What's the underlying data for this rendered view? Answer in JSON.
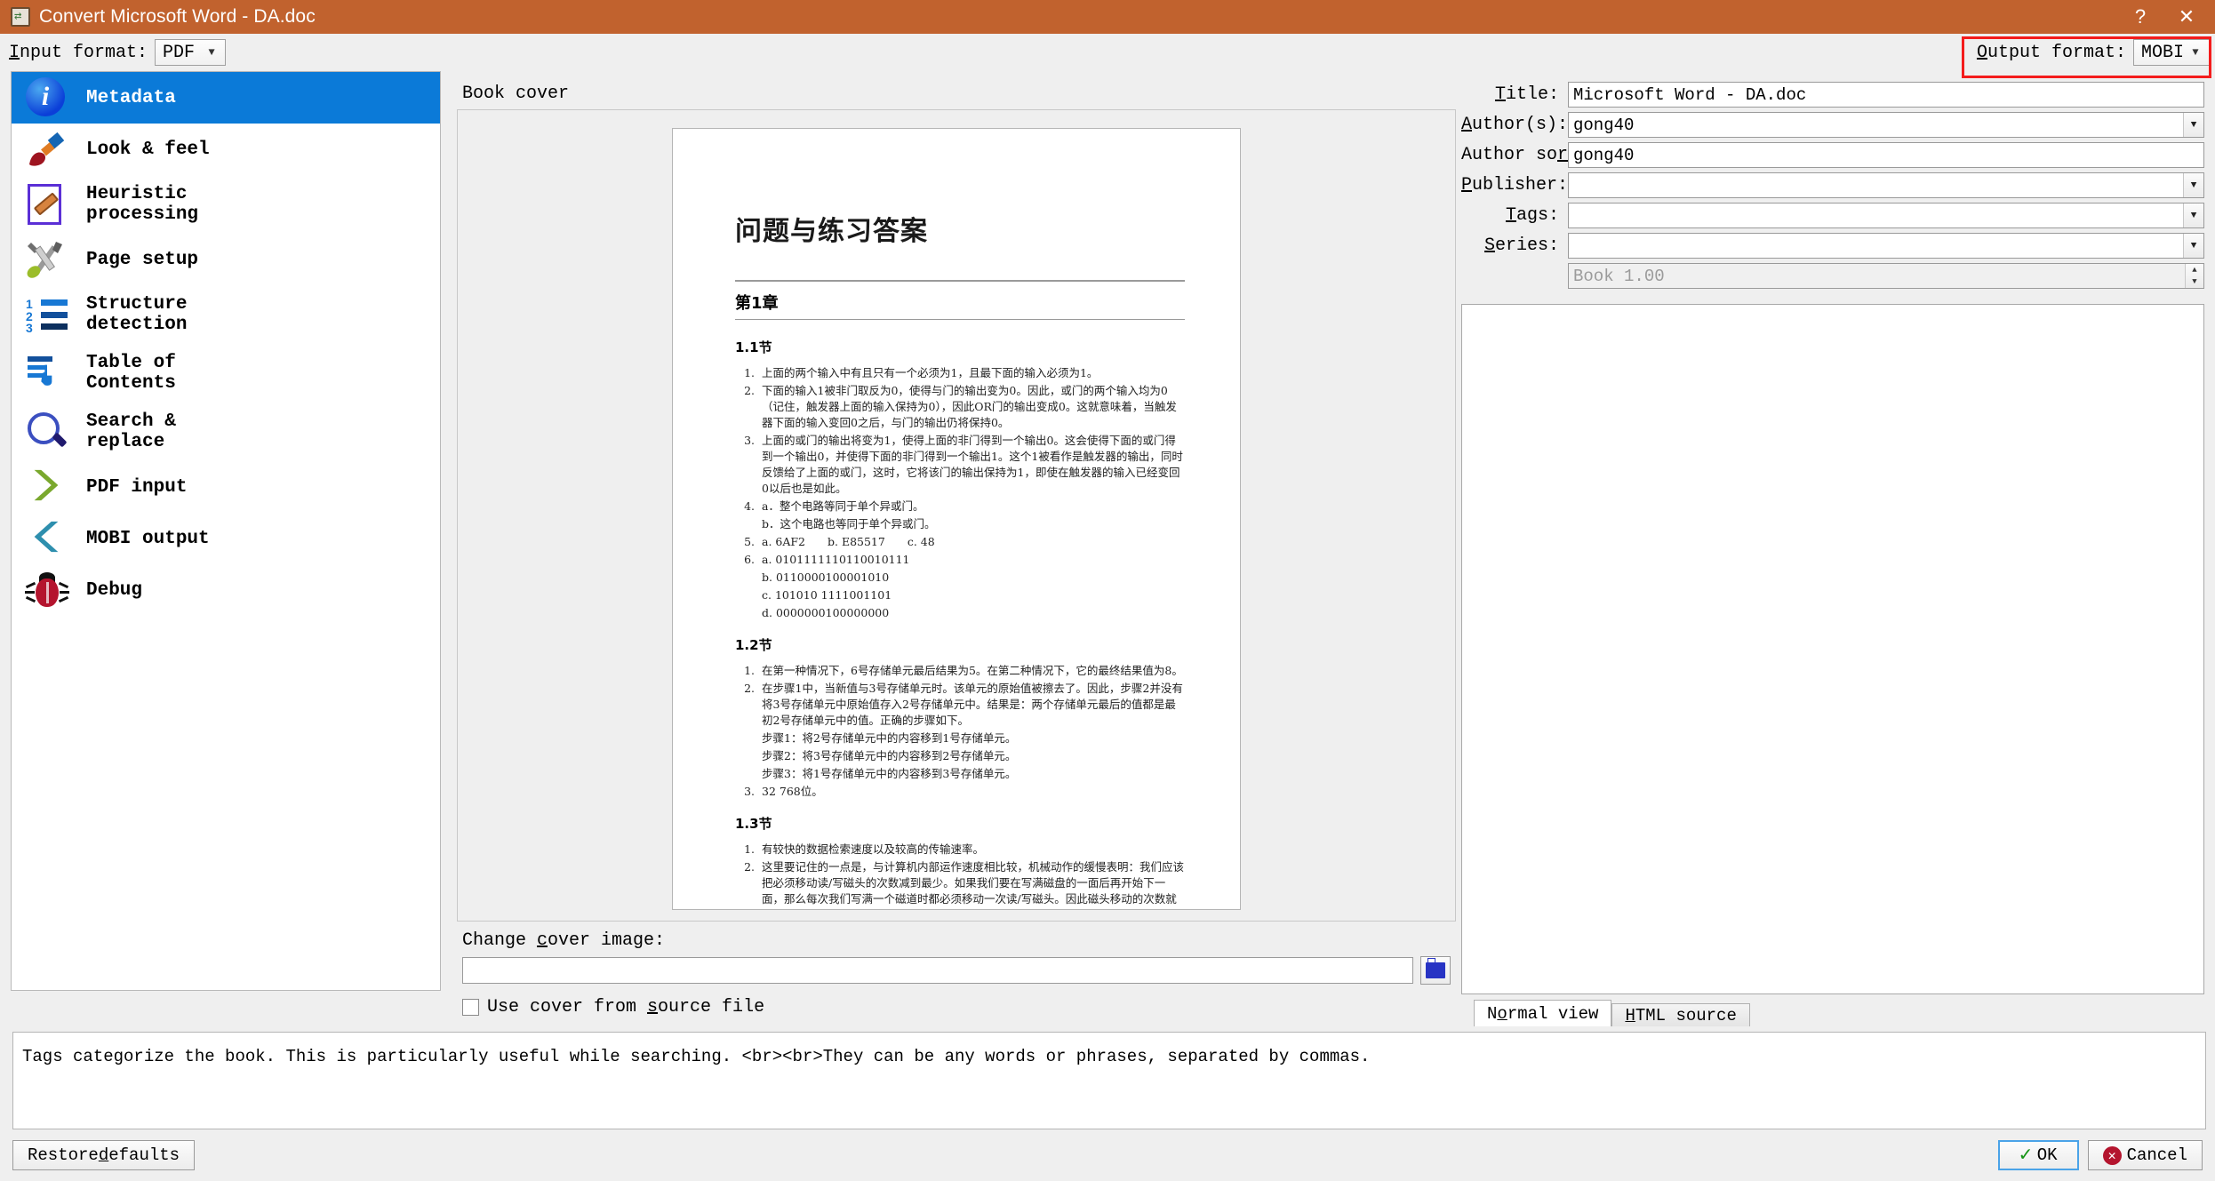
{
  "window": {
    "title": "Convert Microsoft Word - DA.doc",
    "help_button": "?",
    "close_button": "✕"
  },
  "toolbar": {
    "input_format_label": "Input format:",
    "input_format_value": "PDF",
    "output_format_label": "Output format:",
    "output_format_value": "MOBI",
    "highlight_color": "#f41c1c"
  },
  "sidebar": {
    "items": [
      {
        "label": "Metadata",
        "icon": "info-icon",
        "selected": true
      },
      {
        "label": "Look & feel",
        "icon": "paintbrush-icon",
        "selected": false
      },
      {
        "label": "Heuristic\nprocessing",
        "icon": "document-bandage-icon",
        "selected": false
      },
      {
        "label": "Page setup",
        "icon": "tools-icon",
        "selected": false
      },
      {
        "label": "Structure\ndetection",
        "icon": "numbered-list-icon",
        "selected": false
      },
      {
        "label": "Table of\nContents",
        "icon": "toc-hand-icon",
        "selected": false
      },
      {
        "label": "Search &\nreplace",
        "icon": "magnifier-icon",
        "selected": false
      },
      {
        "label": "PDF input",
        "icon": "chevron-right-icon",
        "selected": false
      },
      {
        "label": "MOBI output",
        "icon": "chevron-left-icon",
        "selected": false
      },
      {
        "label": "Debug",
        "icon": "bug-icon",
        "selected": false
      }
    ],
    "selection_color": "#0b7ad8"
  },
  "cover": {
    "section_label": "Book cover",
    "change_label": "Change cover image:",
    "path_value": "",
    "browse_icon": "folder-icon",
    "use_source_label": "Use cover from source file",
    "use_source_checked": false,
    "preview": {
      "title": "问题与练习答案",
      "chapter": "第1章",
      "sections": [
        {
          "heading": "1.1节",
          "items": [
            {
              "n": "1.",
              "text": "上面的两个输入中有且只有一个必须为1，且最下面的输入必须为1。"
            },
            {
              "n": "2.",
              "text": "下面的输入1被非门取反为0，使得与门的输出变为0。因此，或门的两个输入均为0（记住，触发器上面的输入保持为0），因此OR门的输出变成0。这就意味着，当触发器下面的输入变回0之后，与门的输出仍将保持0。"
            },
            {
              "n": "3.",
              "text": "上面的或门的输出将变为1，使得上面的非门得到一个输出0。这会使得下面的或门得到一个输出0，并使得下面的非门得到一个输出1。这个1被看作是触发器的输出，同时反馈给了上面的或门，这时，它将该门的输出保持为1，即使在触发器的输入已经变回0以后也是如此。"
            },
            {
              "n": "4.",
              "text": "a．整个电路等同于单个异或门。"
            },
            {
              "n": "",
              "text": "b．这个电路也等同于单个异或门。"
            },
            {
              "n": "5.",
              "text": "a. 6AF2　　b. E85517　　c. 48"
            },
            {
              "n": "6.",
              "text": "a. 0101111110110010111"
            },
            {
              "n": "",
              "text": "b. 0110000100001010"
            },
            {
              "n": "",
              "text": "c. 101010 1111001101"
            },
            {
              "n": "",
              "text": "d. 0000000100000000"
            }
          ]
        },
        {
          "heading": "1.2节",
          "items": [
            {
              "n": "1.",
              "text": "在第一种情况下，6号存储单元最后结果为5。在第二种情况下，它的最终结果值为8。"
            },
            {
              "n": "2.",
              "text": "在步骤1中，当新值与3号存储单元时。该单元的原始值被擦去了。因此，步骤2并没有将3号存储单元中原始值存入2号存储单元中。结果是：两个存储单元最后的值都是最初2号存储单元中的值。正确的步骤如下。"
            },
            {
              "n": "",
              "text": "步骤1：将2号存储单元中的内容移到1号存储单元。"
            },
            {
              "n": "",
              "text": "步骤2：将3号存储单元中的内容移到2号存储单元。"
            },
            {
              "n": "",
              "text": "步骤3：将1号存储单元中的内容移到3号存储单元。"
            },
            {
              "n": "3.",
              "text": "32 768位。"
            }
          ]
        },
        {
          "heading": "1.3节",
          "items": [
            {
              "n": "1.",
              "text": "有较快的数据检索速度以及较高的传输速率。"
            },
            {
              "n": "2.",
              "text": "这里要记住的一点是，与计算机内部运作速度相比较，机械动作的缓慢表明：我们应该把必须移动读/写磁头的次数减到最少。如果我们要在写满磁盘的一面后再开始下一面，那么每次我们写满一个磁道时都必须移动一次读/写磁头。因此磁头移动的次数就大约等于磁盘两"
            }
          ]
        }
      ]
    }
  },
  "metadata": {
    "fields": [
      {
        "label": "Title:",
        "value": "Microsoft Word - DA.doc",
        "dropdown": false,
        "placeholder": ""
      },
      {
        "label": "Author(s):",
        "value": "gong40",
        "dropdown": true,
        "placeholder": ""
      },
      {
        "label": "Author sort:",
        "value": "gong40",
        "dropdown": false,
        "placeholder": ""
      },
      {
        "label": "Publisher:",
        "value": "",
        "dropdown": true,
        "placeholder": ""
      },
      {
        "label": "Tags:",
        "value": "",
        "dropdown": true,
        "placeholder": ""
      },
      {
        "label": "Series:",
        "value": "",
        "dropdown": true,
        "placeholder": ""
      },
      {
        "label": "",
        "value": "",
        "dropdown": false,
        "spin": true,
        "placeholder": "Book 1.00"
      }
    ],
    "comments_value": "",
    "tabs": [
      {
        "label": "Normal view",
        "active": true
      },
      {
        "label": "HTML source",
        "active": false
      }
    ]
  },
  "help": {
    "text": "Tags categorize the book. This is particularly useful while searching. <br><br>They can be any words or phrases, separated by commas."
  },
  "footer": {
    "restore_label": "Restore defaults",
    "ok_label": "OK",
    "cancel_label": "Cancel"
  }
}
